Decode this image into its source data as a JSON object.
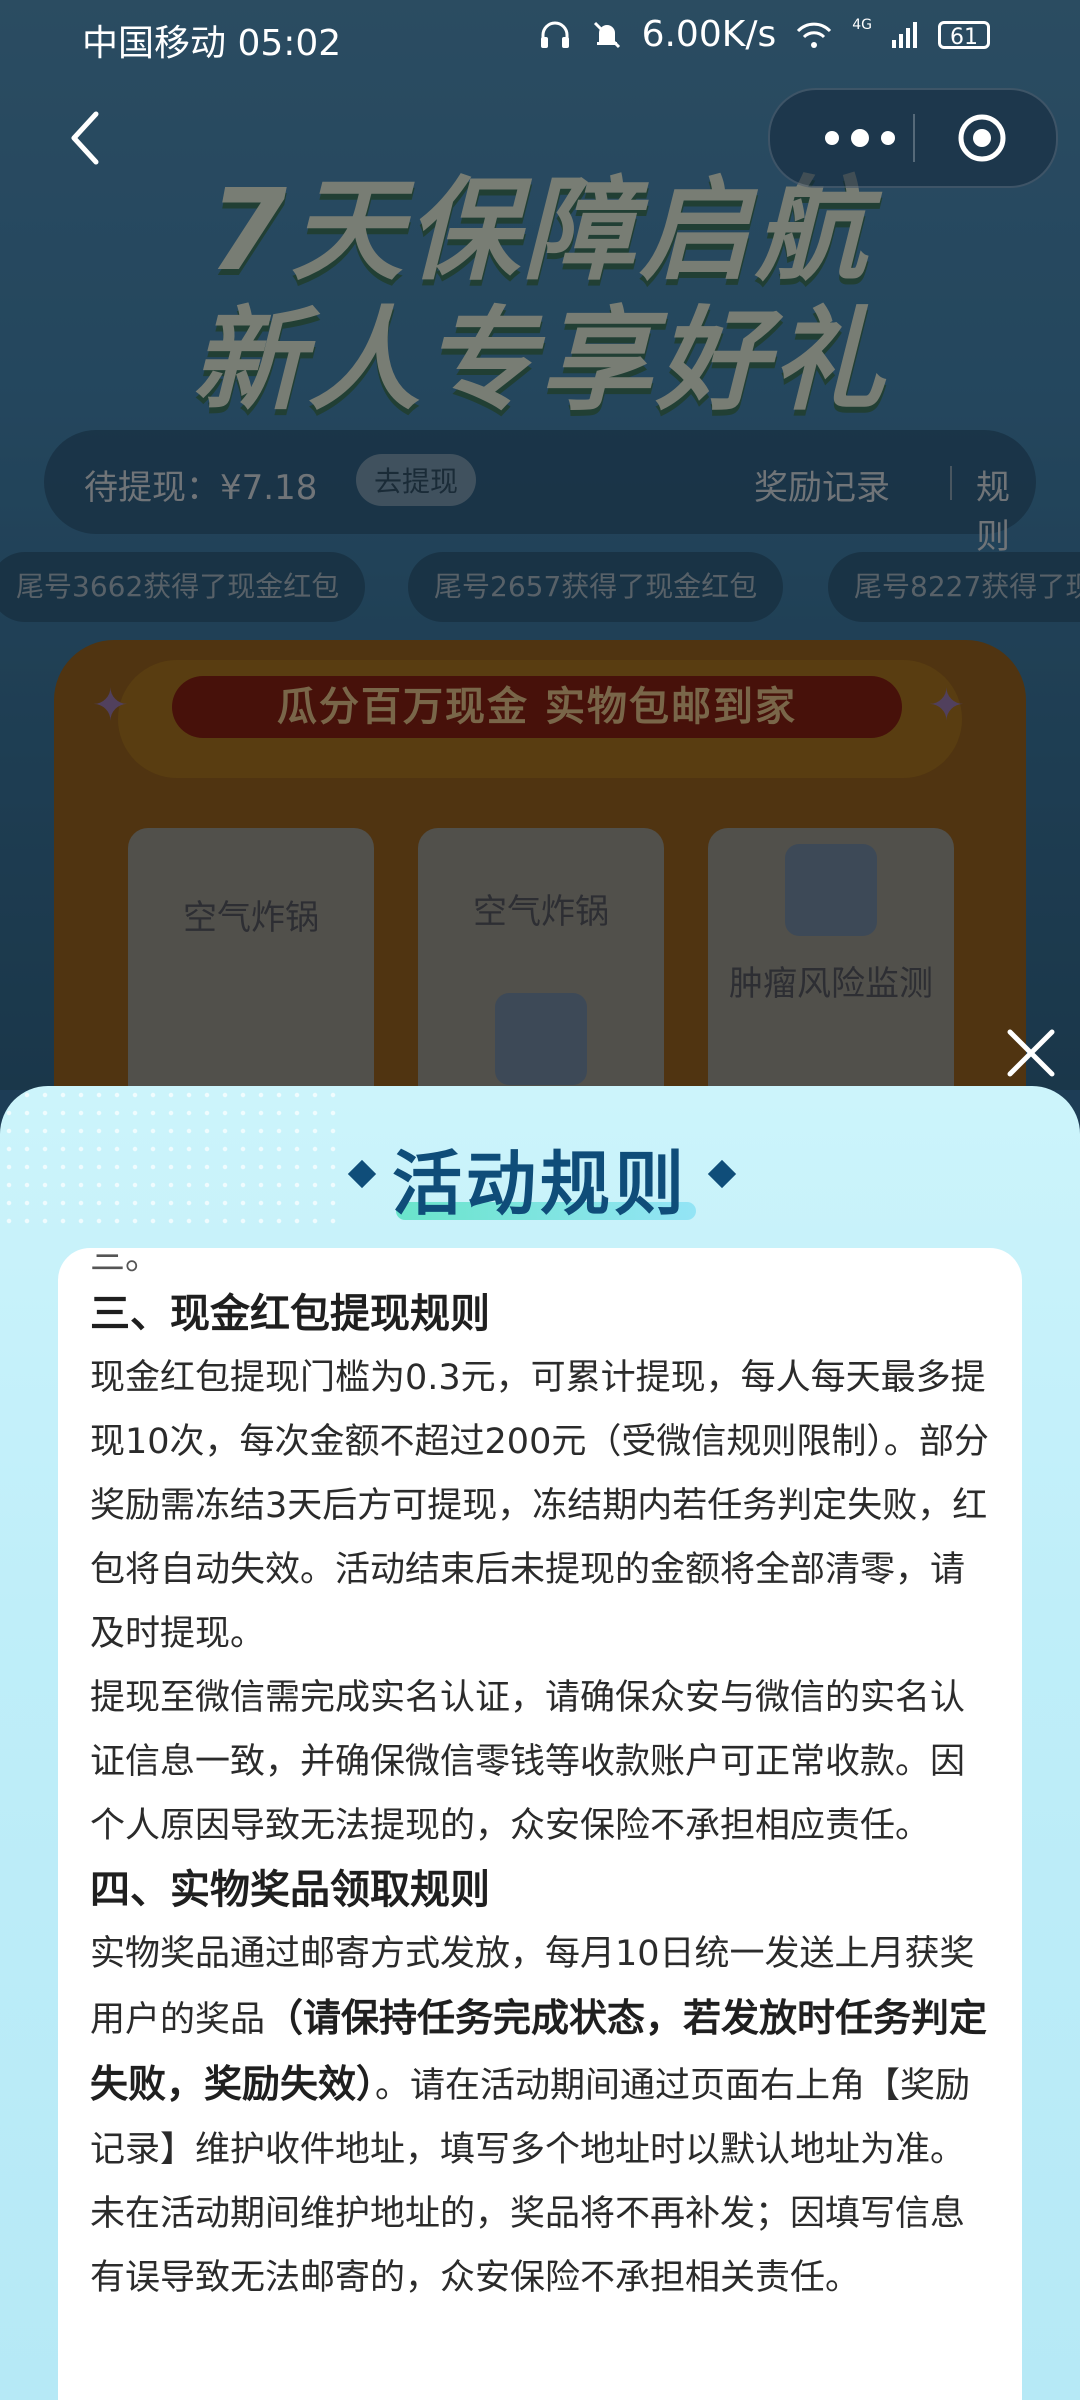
{
  "status_bar": {
    "carrier_time": "中国移动 05:02",
    "net_speed": "6.00K/s",
    "signal_type": "4G",
    "battery": "61"
  },
  "hero": {
    "title_line1": "7天保障启航",
    "title_line2": "新人专享好礼"
  },
  "cash": {
    "pending_label": "待提现：¥7.18",
    "withdraw_button": "去提现",
    "records_link": "奖励记录",
    "rules_link": "规则"
  },
  "ticker": [
    "尾号3662获得了现金红包",
    "尾号2657获得了现金红包",
    "尾号8227获得了现"
  ],
  "machine": {
    "banner": "瓜分百万现金 实物包邮到家",
    "slots": [
      {
        "label": "空气炸锅"
      },
      {
        "label": "空气炸锅"
      },
      {
        "label": "肿瘤风险监测"
      }
    ]
  },
  "sheet": {
    "title": "活动规则",
    "partial_prev": "三。",
    "sections": [
      {
        "heading": "三、现金红包提现规则",
        "paragraphs": [
          "现金红包提现门槛为0.3元，可累计提现，每人每天最多提现10次，每次金额不超过200元（受微信规则限制）。部分奖励需冻结3天后方可提现，冻结期内若任务判定失败，红包将自动失效。活动结束后未提现的金额将全部清零，请及时提现。",
          "提现至微信需完成实名认证，请确保众安与微信的实名认证信息一致，并确保微信零钱等收款账户可正常收款。因个人原因导致无法提现的，众安保险不承担相应责任。"
        ]
      },
      {
        "heading": "四、实物奖品领取规则",
        "p_before": "实物奖品通过邮寄方式发放，每月10日统一发送上月获奖用户的奖品",
        "p_bold": "（请保持任务完成状态，若发放时任务判定失败，奖励失效）",
        "p_after": "。请在活动期间通过页面右上角【奖励记录】维护收件地址，填写多个地址时以默认地址为准。未在活动期间维护地址的，奖品将不再补发；因填写信息有误导致无法邮寄的，众安保险不承担相关责任。"
      }
    ]
  }
}
